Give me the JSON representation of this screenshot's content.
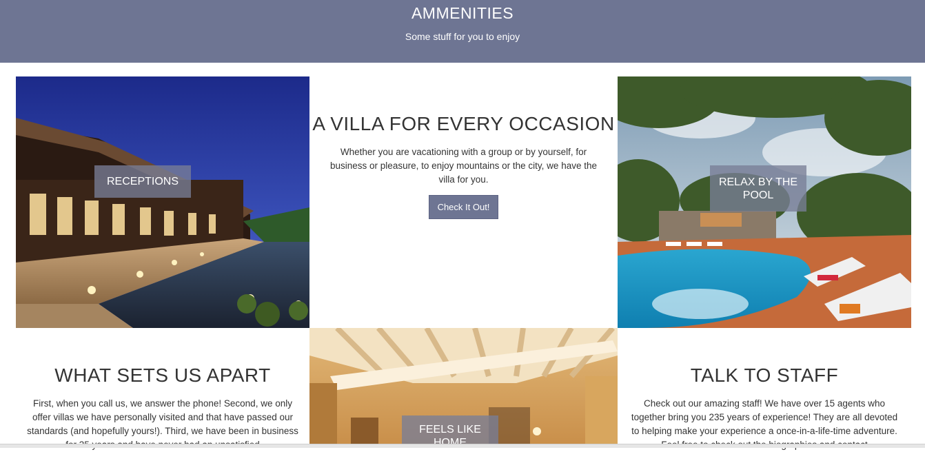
{
  "header": {
    "title": "AMMENITIES",
    "subtitle": "Some stuff for you to enjoy"
  },
  "tiles": {
    "receptions": {
      "label": "RECEPTIONS"
    },
    "occasion": {
      "title": "A VILLA FOR EVERY OCCASION",
      "text": "Whether you are vacationing with a group or by yourself, for business or pleasure, to enjoy mountains or the city, we have the villa for you.",
      "button": "Check It Out!"
    },
    "pool": {
      "label": "RELAX BY THE POOL"
    },
    "apart": {
      "title": "WHAT SETS US APART",
      "text": "First, when you call us, we answer the phone! Second, we only offer villas we have personally visited and that have passed our standards (and hopefully yours!). Third, we have been in business for 35 years and have never had an unsatisfied"
    },
    "home": {
      "label": "FEELS LIKE HOME"
    },
    "staff": {
      "title": "TALK TO STAFF",
      "text": "Check out our amazing staff! We have over 15 agents who together bring you 235 years of experience! They are all devoted to helping make your experience a once-in-a-life-time adventure. Feel free to check out the biographies and contact"
    }
  }
}
